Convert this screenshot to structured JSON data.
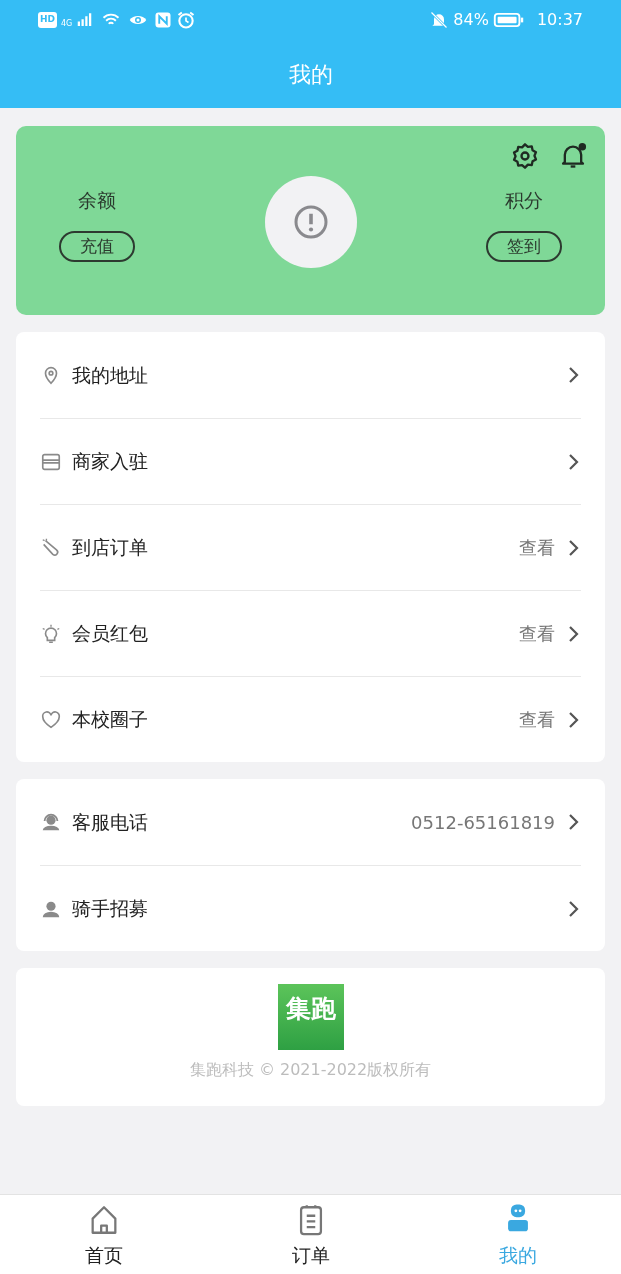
{
  "status_bar": {
    "hd": "HD",
    "network": "4G",
    "battery": "84%",
    "time": "10:37"
  },
  "header": {
    "title": "我的"
  },
  "wallet": {
    "balance_label": "余额",
    "recharge_button": "充值",
    "points_label": "积分",
    "checkin_button": "签到",
    "notification_dot": true
  },
  "menu_groups": [
    {
      "items": [
        {
          "kind": "pin",
          "label": "我的地址"
        },
        {
          "kind": "shop",
          "label": "商家入驻"
        },
        {
          "kind": "tag",
          "label": "到店订单",
          "detail": "查看"
        },
        {
          "kind": "bulb",
          "label": "会员红包",
          "detail": "查看"
        },
        {
          "kind": "heart",
          "label": "本校圈子",
          "detail": "查看"
        }
      ]
    },
    {
      "items": [
        {
          "kind": "headset",
          "label": "客服电话",
          "detail": "0512-65161819"
        },
        {
          "kind": "person",
          "label": "骑手招募"
        }
      ]
    }
  ],
  "footer": {
    "logo_text": "集跑",
    "copyright": "集跑科技 © 2021-2022版权所有"
  },
  "tab_bar": [
    {
      "kind": "home",
      "label": "首页",
      "selected": false
    },
    {
      "kind": "orders",
      "label": "订单",
      "selected": false
    },
    {
      "kind": "me",
      "label": "我的",
      "selected": true
    }
  ]
}
